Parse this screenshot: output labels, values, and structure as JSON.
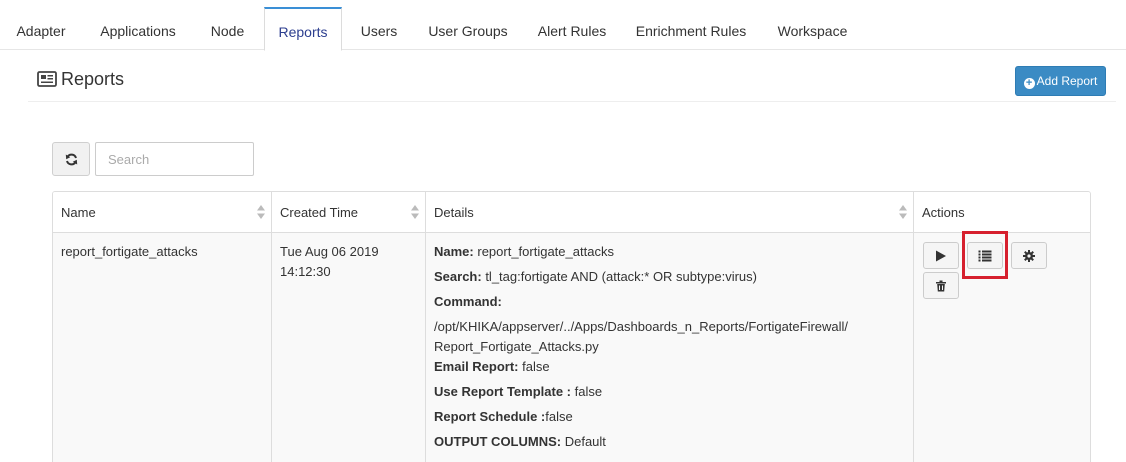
{
  "tabs": [
    {
      "label": "Adapter",
      "active": false
    },
    {
      "label": "Applications",
      "active": false
    },
    {
      "label": "Node",
      "active": false
    },
    {
      "label": "Reports",
      "active": true
    },
    {
      "label": "Users",
      "active": false
    },
    {
      "label": "User Groups",
      "active": false
    },
    {
      "label": "Alert Rules",
      "active": false
    },
    {
      "label": "Enrichment Rules",
      "active": false
    },
    {
      "label": "Workspace",
      "active": false
    }
  ],
  "header": {
    "title": "Reports",
    "icon": "newspaper-icon",
    "add_button_label": "Add Report"
  },
  "toolbar": {
    "refresh_icon": "refresh-icon",
    "search_placeholder": "Search"
  },
  "table": {
    "columns": [
      "Name",
      "Created Time",
      "Details",
      "Actions"
    ],
    "rows": [
      {
        "name": "report_fortigate_attacks",
        "created_line1": "Tue Aug 06 2019",
        "created_line2": "14:12:30",
        "details": {
          "name_label": "Name:",
          "name_value": " report_fortigate_attacks",
          "search_label": "Search:",
          "search_value": " tl_tag:fortigate AND (attack:* OR subtype:virus)",
          "command_label": "Command:",
          "command_line1": "/opt/KHIKA/appserver/../Apps/Dashboards_n_Reports/FortigateFirewall/",
          "command_line2": "Report_Fortigate_Attacks.py",
          "email_label": "Email Report:",
          "email_value": " false",
          "template_label": "Use Report Template :",
          "template_value": " false",
          "schedule_label": "Report Schedule :",
          "schedule_value": "false",
          "output_label": "OUTPUT COLUMNS:",
          "output_value": " Default"
        },
        "actions": [
          "play-icon",
          "list-icon",
          "gear-icon",
          "trash-icon"
        ]
      }
    ]
  },
  "colors": {
    "accent": "#3b8bc4",
    "active_tab_text": "#2c3e8f",
    "highlight": "#d6202e"
  }
}
